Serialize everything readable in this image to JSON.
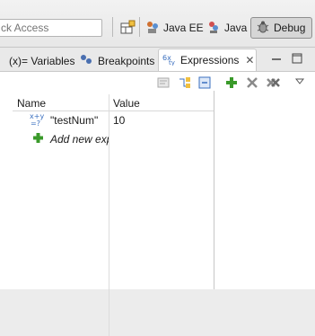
{
  "quick_access": {
    "placeholder": "ck Access"
  },
  "perspectives": [
    {
      "label": "Java EE"
    },
    {
      "label": "Java"
    },
    {
      "label": "Debug"
    }
  ],
  "tabs": [
    {
      "label": "(x)= Variables"
    },
    {
      "label": "Breakpoints"
    },
    {
      "label": "Expressions"
    }
  ],
  "table": {
    "columns": [
      "Name",
      "Value"
    ],
    "rows": [
      {
        "name": "\"testNum\"",
        "value": "10"
      }
    ],
    "add_new_label": "Add new exp"
  },
  "colors": {
    "add_green": "#3a9a2a",
    "icon_blue": "#3a6fbf",
    "tab_border": "#c9c9c9"
  }
}
